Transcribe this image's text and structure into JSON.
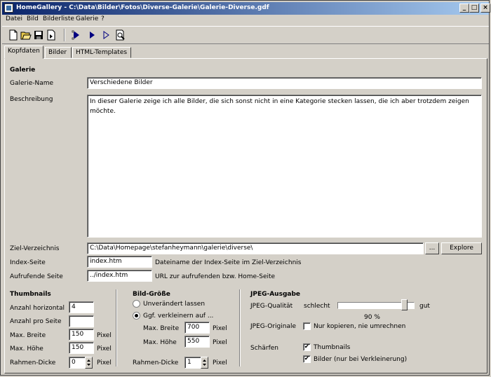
{
  "window": {
    "title": "HomeGallery - C:\\Data\\Bilder\\Fotos\\Diverse-Galerie\\Galerie-Diverse.gdf"
  },
  "menu": [
    "Datei",
    "Bild",
    "Bilderliste",
    "Galerie",
    "?"
  ],
  "tabs": [
    "Kopfdaten",
    "Bilder",
    "HTML-Templates"
  ],
  "galerie": {
    "heading": "Galerie",
    "name_label": "Galerie-Name",
    "name_value": "Verschiedene Bilder",
    "desc_label": "Beschreibung",
    "desc_value": "In dieser Galerie zeige ich alle Bilder, die sich sonst nicht in eine Kategorie stecken lassen, die ich aber trotzdem zeigen möchte."
  },
  "ziel": {
    "label": "Ziel-Verzeichnis",
    "value": "C:\\Data\\Homepage\\stefanheymann\\galerie\\diverse\\",
    "browse": "...",
    "explore": "Explore"
  },
  "index": {
    "label": "Index-Seite",
    "value": "index.htm",
    "hint": "Dateiname der Index-Seite im Ziel-Verzeichnis"
  },
  "aufrufend": {
    "label": "Aufrufende Seite",
    "value": "../index.htm",
    "hint": "URL zur aufrufenden bzw. Home-Seite"
  },
  "thumbnails": {
    "heading": "Thumbnails",
    "horiz_label": "Anzahl horizontal",
    "horiz_value": "4",
    "pro_seite_label": "Anzahl pro Seite",
    "pro_seite_value": "",
    "breite_label": "Max. Breite",
    "breite_value": "150",
    "hoehe_label": "Max. Höhe",
    "hoehe_value": "150",
    "rahmen_label": "Rahmen-Dicke",
    "rahmen_value": "0",
    "unit": "Pixel"
  },
  "bildgroesse": {
    "heading": "Bild-Größe",
    "opt_unchanged": "Unverändert lassen",
    "opt_shrink": "Ggf. verkleinern auf ...",
    "selected": "shrink",
    "breite_label": "Max. Breite",
    "breite_value": "700",
    "hoehe_label": "Max. Höhe",
    "hoehe_value": "550",
    "rahmen_label": "Rahmen-Dicke",
    "rahmen_value": "1",
    "unit": "Pixel"
  },
  "jpeg": {
    "heading": "JPEG-Ausgabe",
    "quality_label": "JPEG-Qualität",
    "low": "schlecht",
    "high": "gut",
    "quality_value": 0.9,
    "quality_text": "90 %",
    "originale_label": "JPEG-Originale",
    "originale_option": "Nur kopieren, nie umrechnen",
    "originale_checked": false,
    "schaerfen_label": "Schärfen",
    "thumbs_option": "Thumbnails",
    "thumbs_checked": true,
    "bilder_option": "Bilder (nur bei Verkleinerung)",
    "bilder_checked": true
  },
  "icons": [
    "new-icon",
    "open-icon",
    "save-icon",
    "export-icon",
    "run-all-icon",
    "run-icon",
    "run-outline-icon",
    "preview-icon"
  ],
  "colors": {
    "titlebar_start": "#0a246a",
    "titlebar_end": "#a6caf0",
    "face": "#d4d0c8"
  }
}
